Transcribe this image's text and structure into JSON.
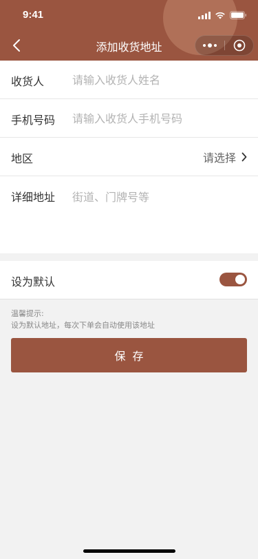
{
  "status_bar": {
    "time": "9:41"
  },
  "nav": {
    "title": "添加收货地址"
  },
  "form": {
    "consignee": {
      "label": "收货人",
      "placeholder": "请输入收货人姓名"
    },
    "phone": {
      "label": "手机号码",
      "placeholder": "请输入收货人手机号码"
    },
    "region": {
      "label": "地区",
      "value": "请选择"
    },
    "address": {
      "label": "详细地址",
      "placeholder": "街道、门牌号等"
    }
  },
  "default_setting": {
    "label": "设为默认",
    "enabled": true
  },
  "tip": {
    "title": "温馨提示:",
    "text": "设为默认地址，每次下单会自动使用该地址"
  },
  "save_button": {
    "label": "保存"
  },
  "colors": {
    "accent": "#9a5540",
    "background": "#f2f2f2"
  }
}
